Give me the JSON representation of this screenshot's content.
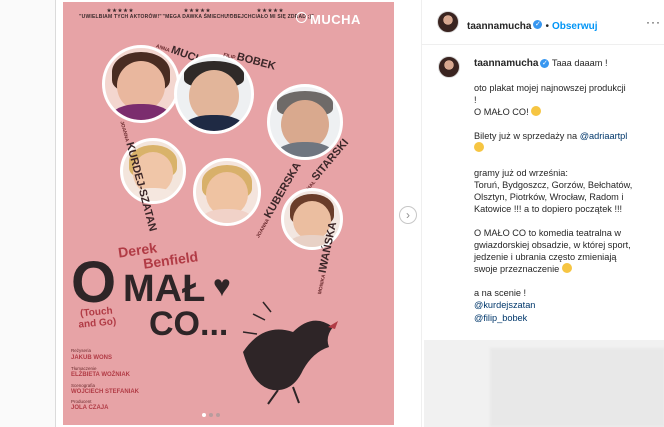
{
  "poster": {
    "quotes": [
      {
        "stars": "★★★★★",
        "text": "\"UWIELBIAM TYCH AKTORÓW!\""
      },
      {
        "stars": "★★★★★",
        "text": "\"MEGA DAWKA ŚMIECHU!\""
      },
      {
        "stars": "★★★★★",
        "text": "\"OBEJCHCIAŁO MI SIĘ ZDRAD ;)\""
      }
    ],
    "brand": "MUCHA",
    "cast": [
      {
        "first": "ANNA",
        "last": "Mucha"
      },
      {
        "first": "FILIP",
        "last": "Bobek"
      },
      {
        "first": "MICHAŁ",
        "last": "Sitarski"
      },
      {
        "first": "JOANNA",
        "last": "Kurdej-Szatan"
      },
      {
        "first": "JOANNA",
        "last": "Kuberska"
      },
      {
        "first": "MONIKA",
        "last": "Iwańska"
      }
    ],
    "author_first": "Derek",
    "author_last": "Benfield",
    "title_o": "O",
    "title_malo": "MAŁ",
    "title_co": "CO...",
    "subtitle": "(Touch\nand Go)",
    "credits": [
      {
        "label": "Reżyseria",
        "name": "JAKUB WONS"
      },
      {
        "label": "Tłumaczenie",
        "name": "ELŻBIETA WOŹNIAK"
      },
      {
        "label": "Scenografia",
        "name": "WOJCIECH STEFANIAK"
      },
      {
        "label": "Producent",
        "name": "JOLA CZAJA"
      }
    ],
    "colors": {
      "background": "#e7a3a6",
      "accent": "#b13b45",
      "dark": "#2e2527"
    }
  },
  "carousel": {
    "slides": 3,
    "active": 1,
    "next_icon": "chevron-right-icon"
  },
  "post": {
    "username": "taannamucha",
    "verified": true,
    "follow_label": "Obserwuj",
    "separator": "•",
    "more_icon": "more-options-icon",
    "caption_intro": "Taaa daaam !",
    "caption_paragraphs": [
      "oto plakat mojej najnowszej produkcji\n!\nO MAŁO CO! ",
      "Bilety już w sprzedaży na ",
      "gramy już od września:\nToruń, Bydgoszcz, Gorzów, Bełchatów,\nOlsztyn, Piotrków, Wrocław, Radom i\nKatowice !!! a to dopiero początek !!!",
      "O MAŁO CO to komedia teatralna w\ngwiazdorskiej obsadzie, w której sport,\njedzenie i ubrania często zmieniają\nswoje przeznaczenie ",
      "a na scenie !"
    ],
    "mentions": [
      "@adriaartpl",
      "@kurdejszatan",
      "@filip_bobek"
    ]
  }
}
